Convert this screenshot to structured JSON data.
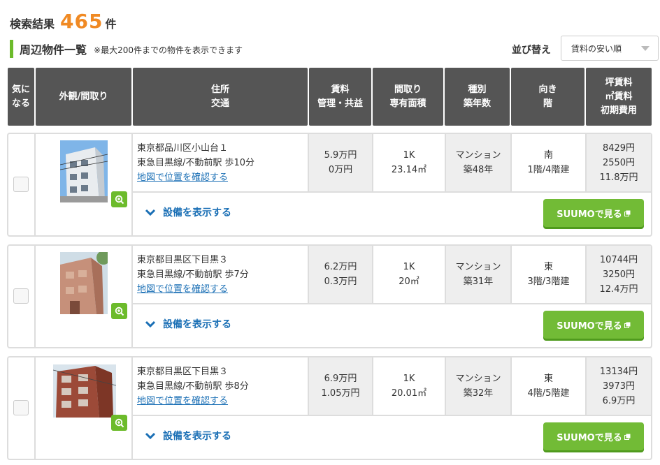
{
  "search": {
    "label": "検索結果",
    "count": "465",
    "unit": "件"
  },
  "section": {
    "title": "周辺物件一覧",
    "note": "※最大200件までの物件を表示できます"
  },
  "sort": {
    "label": "並び替え",
    "selected": "賃料の安い順"
  },
  "table_headers": {
    "favorite": "気に\nなる",
    "photo": "外観/間取り",
    "address": "住所\n交通",
    "rent": "賃料\n管理・共益",
    "layout": "間取り\n専有面積",
    "type": "種別\n築年数",
    "direction": "向き\n階",
    "tsubo": "坪賃料\n㎡賃料\n初期費用"
  },
  "listings": [
    {
      "address": "東京都品川区小山台１",
      "access": "東急目黒線/不動前駅 歩10分",
      "map_link": "地図で位置を確認する",
      "rent": "5.9万円",
      "fee": "0万円",
      "layout": "1K",
      "area": "23.14㎡",
      "type": "マンション",
      "age": "築48年",
      "direction": "南",
      "floor": "1階/4階建",
      "tsubo": "8429円",
      "sqm": "2550円",
      "initial": "11.8万円",
      "equip": "設備を表示する",
      "suumo": "SUUMOで見る"
    },
    {
      "address": "東京都目黒区下目黒３",
      "access": "東急目黒線/不動前駅 歩7分",
      "map_link": "地図で位置を確認する",
      "rent": "6.2万円",
      "fee": "0.3万円",
      "layout": "1K",
      "area": "20㎡",
      "type": "マンション",
      "age": "築31年",
      "direction": "東",
      "floor": "3階/3階建",
      "tsubo": "10744円",
      "sqm": "3250円",
      "initial": "12.4万円",
      "equip": "設備を表示する",
      "suumo": "SUUMOで見る"
    },
    {
      "address": "東京都目黒区下目黒３",
      "access": "東急目黒線/不動前駅 歩8分",
      "map_link": "地図で位置を確認する",
      "rent": "6.9万円",
      "fee": "1.05万円",
      "layout": "1K",
      "area": "20.01㎡",
      "type": "マンション",
      "age": "築32年",
      "direction": "東",
      "floor": "4階/5階建",
      "tsubo": "13134円",
      "sqm": "3973円",
      "initial": "6.9万円",
      "equip": "設備を表示する",
      "suumo": "SUUMOで見る"
    }
  ],
  "colors": {
    "accent_orange": "#f08a24",
    "green": "#6cbb2b",
    "header_bg": "#555555",
    "link": "#1a6fb5"
  }
}
